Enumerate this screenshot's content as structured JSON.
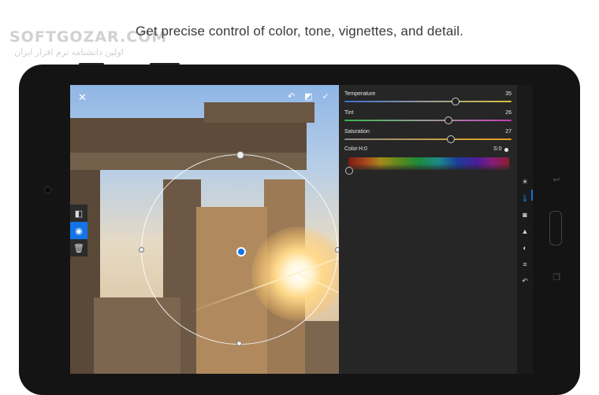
{
  "headline": "Get precise control of color, tone, vignettes, and detail.",
  "watermark": {
    "brand": "SOFTGOZAR.COM",
    "tagline": "اولین دانشنامه نرم افزار ایران"
  },
  "editor": {
    "close_icon": "close-icon",
    "top_icons": [
      "undo-icon",
      "crop-icon",
      "checkmark-icon"
    ],
    "left_tools": [
      {
        "name": "mask-icon",
        "active": false
      },
      {
        "name": "radial-filter-icon",
        "active": true
      },
      {
        "name": "trash-icon",
        "active": false
      }
    ]
  },
  "panel": {
    "temperature": {
      "label": "Temperature",
      "value": "35",
      "fraction": 0.66
    },
    "tint": {
      "label": "Tint",
      "value": "26",
      "fraction": 0.62
    },
    "saturation": {
      "label": "Saturation",
      "value": "27",
      "fraction": 0.63
    },
    "color": {
      "label": "Color",
      "hue_label": "H:0",
      "sat_label": "S:0"
    }
  },
  "rail": [
    {
      "name": "light-icon",
      "glyph": "☀",
      "active": false
    },
    {
      "name": "color-thermometer-icon",
      "glyph": "🌡",
      "active": true
    },
    {
      "name": "vignette-icon",
      "glyph": "◙",
      "active": false
    },
    {
      "name": "detail-icon",
      "glyph": "▲",
      "active": false
    },
    {
      "name": "optics-icon",
      "glyph": "◐",
      "active": false
    },
    {
      "name": "geometry-icon",
      "glyph": "≡",
      "active": false
    },
    {
      "name": "reset-icon",
      "glyph": "↶",
      "active": false
    }
  ],
  "colors": {
    "accent": "#1473e6",
    "panel": "#262626"
  }
}
